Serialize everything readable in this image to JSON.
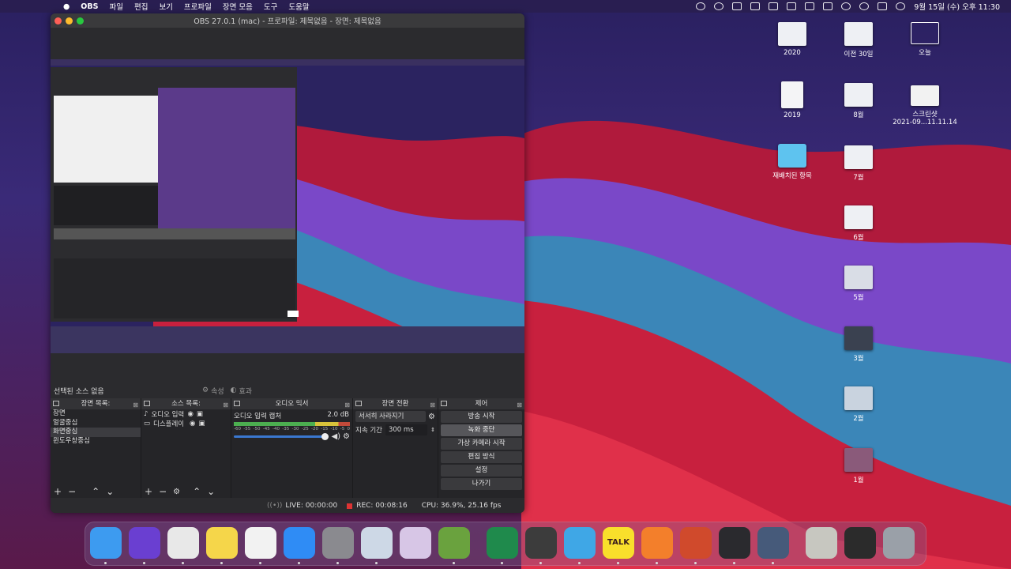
{
  "menubar": {
    "apple": "",
    "app": "OBS",
    "items": [
      "파일",
      "편집",
      "보기",
      "프로파일",
      "장면 모음",
      "도구",
      "도움말"
    ],
    "clock": "9월 15일 (수) 오후 11:30"
  },
  "obs": {
    "title": "OBS 27.0.1 (mac) - 프로파일: 제목없음 - 장면: 제목없음",
    "selected_source": "선택된 소스 없음",
    "properties_tab": "속성",
    "filters_tab": "효과",
    "scenes": {
      "header": "장면 목록:",
      "items": [
        "장면",
        "얼굴중심",
        "화면중심",
        "윈도우창중심"
      ],
      "selected_index": 2
    },
    "sources": {
      "header": "소스 목록:",
      "items": [
        "오디오 입력 캡처",
        "디스플레이 캡처"
      ]
    },
    "mixer": {
      "header": "오디오 믹서",
      "channel": "오디오 입력 캡처",
      "db": "2.0 dB",
      "ticks": [
        "-60",
        "-55",
        "-50",
        "-45",
        "-40",
        "-35",
        "-30",
        "-25",
        "-20",
        "-15",
        "-10",
        "-5",
        "0"
      ]
    },
    "transitions": {
      "header": "장면 전환",
      "type": "서서히 사라지기",
      "duration_label": "지속 기간",
      "duration_value": "300 ms"
    },
    "controls": {
      "header": "제어",
      "buttons": [
        "방송 시작",
        "녹화 중단",
        "가상 카메라 시작",
        "편집 방식",
        "설정",
        "나가기"
      ],
      "active_index": 1
    },
    "status": {
      "live": "LIVE: 00:00:00",
      "rec": "REC: 00:08:16",
      "cpu": "CPU: 36.9%, 25.16 fps"
    }
  },
  "desktop": {
    "icons": [
      {
        "label": "2020",
        "kind": "doc-stack"
      },
      {
        "label": "이전 30일",
        "kind": "doc-stack"
      },
      {
        "label": "오늘",
        "kind": "outline"
      },
      {
        "label": "2019",
        "kind": "doc"
      },
      {
        "label": "8월",
        "kind": "doc-stack"
      },
      {
        "label": "스크린샷\n2021-09...11.11.14",
        "kind": "screenshot"
      },
      {
        "label": "재배치된 항목",
        "kind": "folder"
      },
      {
        "label": "7월",
        "kind": "doc-stack"
      },
      {
        "label": "6월",
        "kind": "doc-stack"
      },
      {
        "label": "5월",
        "kind": "image"
      },
      {
        "label": "3월",
        "kind": "dark"
      },
      {
        "label": "2월",
        "kind": "image"
      },
      {
        "label": "1월",
        "kind": "image"
      }
    ]
  },
  "dock": {
    "apps": [
      {
        "name": "finder",
        "color": "#3d9bf0"
      },
      {
        "name": "siri",
        "color": "#6a3fd1"
      },
      {
        "name": "chrome",
        "color": "#e8e8e8"
      },
      {
        "name": "notes",
        "color": "#f5d64a"
      },
      {
        "name": "photos",
        "color": "#f2f2f2"
      },
      {
        "name": "app-store",
        "color": "#2f8cf5"
      },
      {
        "name": "system-preferences",
        "color": "#8a8a8f"
      },
      {
        "name": "preview",
        "color": "#cdd8e6"
      },
      {
        "name": "launchpad",
        "color": "#d7c6e6"
      },
      {
        "name": "minecraft",
        "color": "#6aa23e"
      },
      {
        "name": "excel",
        "color": "#1f8a4c"
      },
      {
        "name": "sublime-text",
        "color": "#3c3c3c"
      },
      {
        "name": "sheets-app",
        "color": "#3fa7e6"
      },
      {
        "name": "kakaotalk",
        "color": "#f9df2b"
      },
      {
        "name": "mindnode",
        "color": "#f37f2b"
      },
      {
        "name": "powerpoint",
        "color": "#d04a2c"
      },
      {
        "name": "obs",
        "color": "#2a2a2e"
      },
      {
        "name": "quicktime",
        "color": "#465a7a"
      },
      {
        "name": "downloads-stack",
        "color": "#c7c7c0"
      },
      {
        "name": "documents-stack",
        "color": "#2b2b2b"
      },
      {
        "name": "trash",
        "color": "#9aa0a8"
      }
    ],
    "talk_label": "TALK"
  }
}
